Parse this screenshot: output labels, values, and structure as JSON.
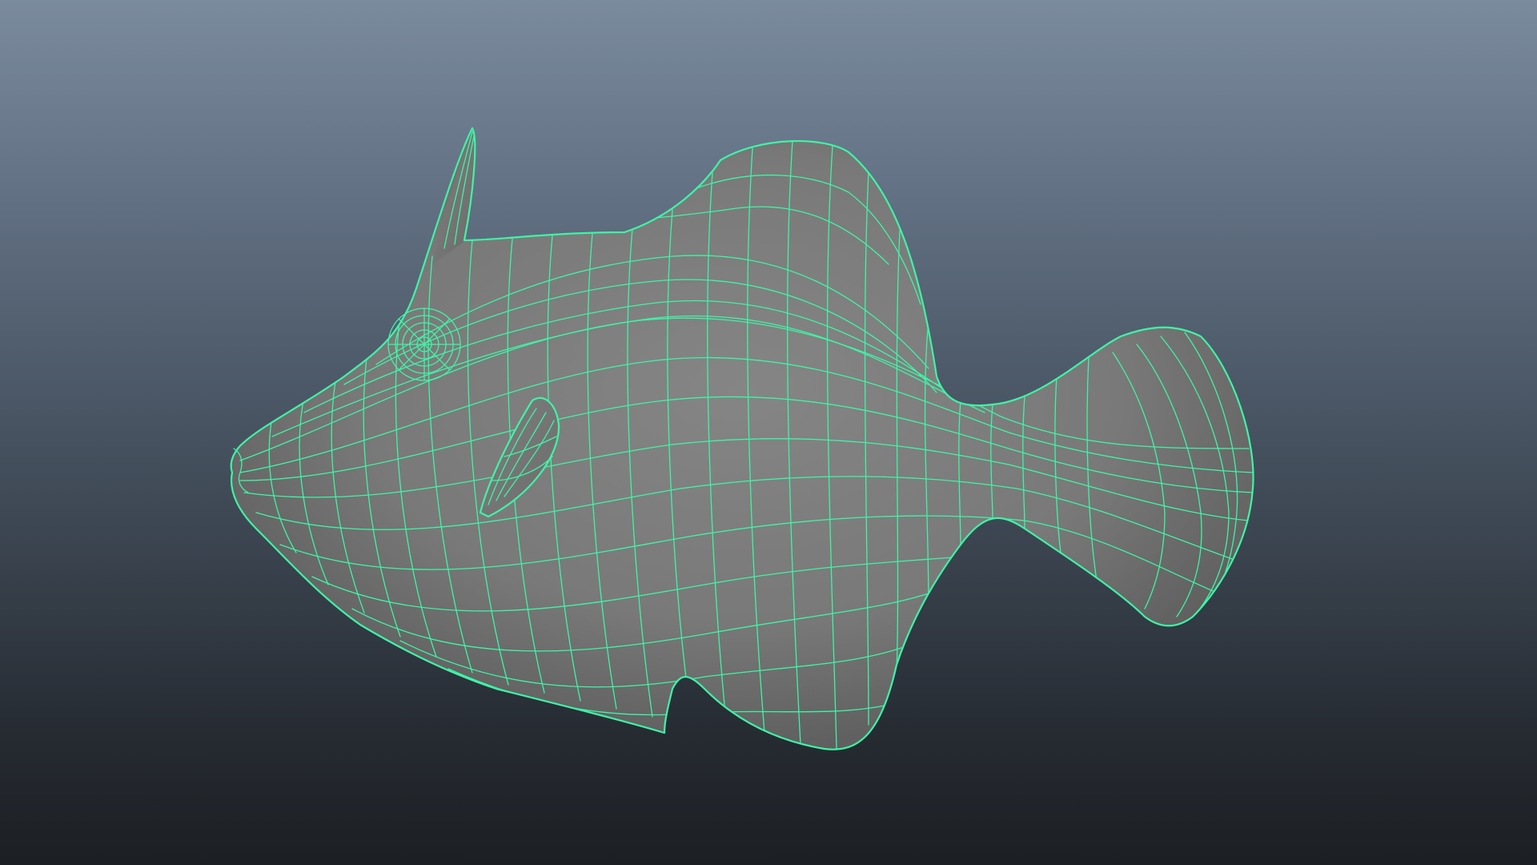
{
  "viewport": {
    "background_top": "#7b8b9e",
    "background_bottom": "#1c1f23",
    "wireframe_color": "#3df5a6",
    "surface_color": "#7a7a7a"
  },
  "model": {
    "subject": "fish",
    "display_mode": "wireframe-on-shaded",
    "selected": true
  }
}
